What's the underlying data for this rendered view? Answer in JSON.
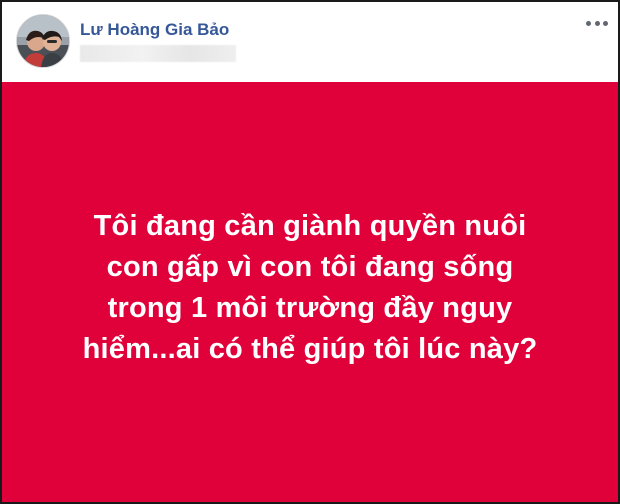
{
  "post": {
    "author_name": "Lư Hoàng Gia Bảo",
    "avatar_icon": "profile-photo-avatar",
    "menu_icon": "more-options-icon",
    "background_color": "#e0003a",
    "text_lines": [
      "Tôi đang cần giành quyền nuôi",
      "con gấp vì con tôi đang sống",
      "trong 1 môi trường đầy nguy",
      "hiểm...ai có thể giúp tôi lúc này?"
    ]
  },
  "colors": {
    "author_link": "#365899",
    "post_text": "#ffffff"
  }
}
